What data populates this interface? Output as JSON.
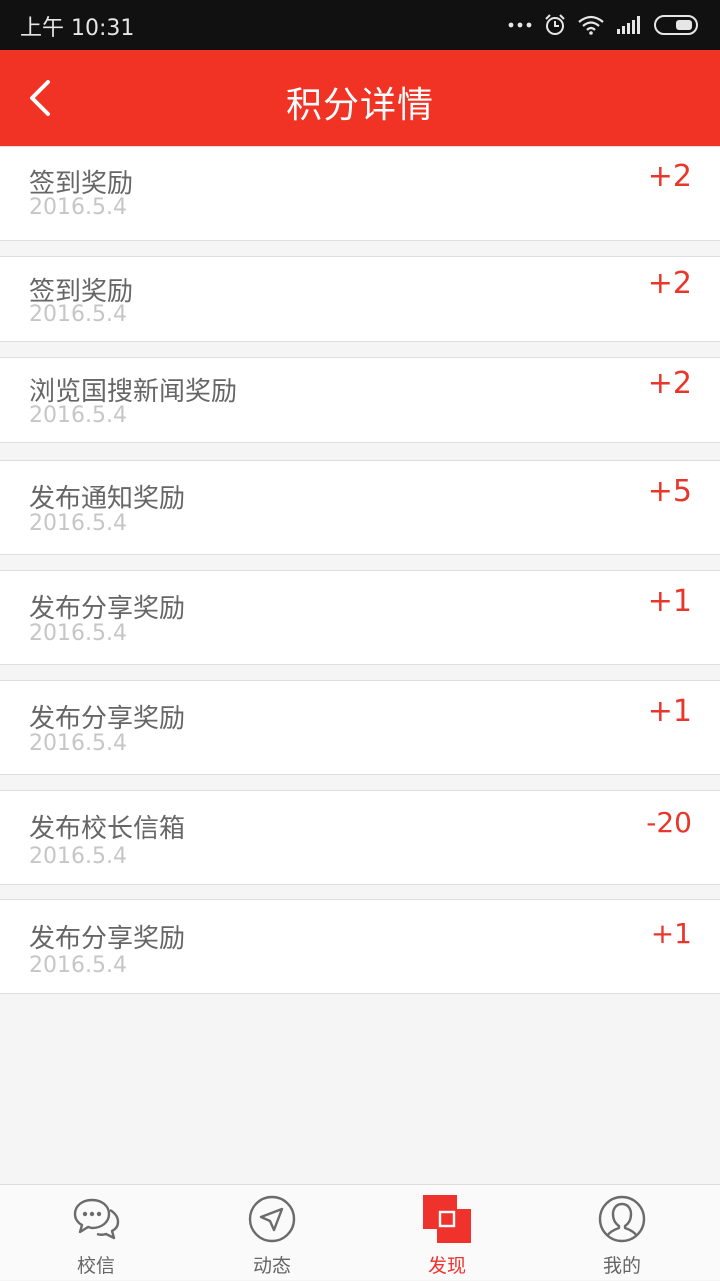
{
  "status_bar": {
    "time": "上午 10:31",
    "icons": [
      "more-dots-icon",
      "alarm-icon",
      "wifi-icon",
      "signal-icon",
      "battery-icon"
    ]
  },
  "header": {
    "title": "积分详情",
    "back_icon": "chevron-left-icon",
    "color": "#f03325"
  },
  "records": [
    {
      "title": "签到奖励",
      "date": "2016.5.4",
      "points": "+2"
    },
    {
      "title": "签到奖励",
      "date": "2016.5.4",
      "points": "+2"
    },
    {
      "title": "浏览国搜新闻奖励",
      "date": "2016.5.4",
      "points": "+2"
    },
    {
      "title": "发布通知奖励",
      "date": "2016.5.4",
      "points": "+5"
    },
    {
      "title": "发布分享奖励",
      "date": "2016.5.4",
      "points": "+1"
    },
    {
      "title": "发布分享奖励",
      "date": "2016.5.4",
      "points": "+1"
    },
    {
      "title": "发布校长信箱",
      "date": "2016.5.4",
      "points": "-20"
    },
    {
      "title": "发布分享奖励",
      "date": "2016.5.4",
      "points": "+1"
    }
  ],
  "tabs": [
    {
      "label": "校信",
      "icon": "chat-bubble-icon",
      "active": false
    },
    {
      "label": "动态",
      "icon": "compass-icon",
      "active": false
    },
    {
      "label": "发现",
      "icon": "discover-squares-icon",
      "active": true
    },
    {
      "label": "我的",
      "icon": "user-profile-icon",
      "active": false
    }
  ],
  "colors": {
    "accent": "#f03325",
    "points": "#e8362b",
    "active_tab": "#f0322d"
  }
}
